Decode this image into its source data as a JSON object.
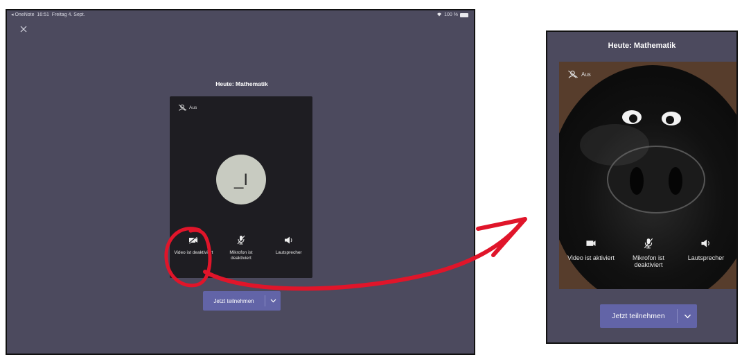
{
  "status_bar": {
    "app": "◂ OneNote",
    "time": "16:51",
    "date": "Freitag 4. Sept.",
    "battery": "100 %"
  },
  "left_screen": {
    "close_icon": "close-icon",
    "title": "Heute: Mathematik",
    "bg_label": "Aus",
    "avatar_initials": "_I",
    "controls": [
      {
        "label": "Video ist deaktiviert",
        "icon": "video-off-icon"
      },
      {
        "label": "Mikrofon ist deaktiviert",
        "icon": "mic-off-icon"
      },
      {
        "label": "Lautsprecher",
        "icon": "speaker-icon"
      }
    ],
    "join_label": "Jetzt teilnehmen"
  },
  "right_screen": {
    "title": "Heute: Mathematik",
    "bg_label": "Aus",
    "controls": [
      {
        "label": "Video ist aktiviert",
        "icon": "video-on-icon"
      },
      {
        "label": "Mikrofon ist deaktiviert",
        "icon": "mic-off-icon"
      },
      {
        "label": "Lautsprecher",
        "icon": "speaker-icon"
      }
    ],
    "join_label": "Jetzt teilnehmen"
  },
  "colors": {
    "background": "#4c4a5e",
    "primary": "#6264a7",
    "annotation": "#e0152a"
  }
}
